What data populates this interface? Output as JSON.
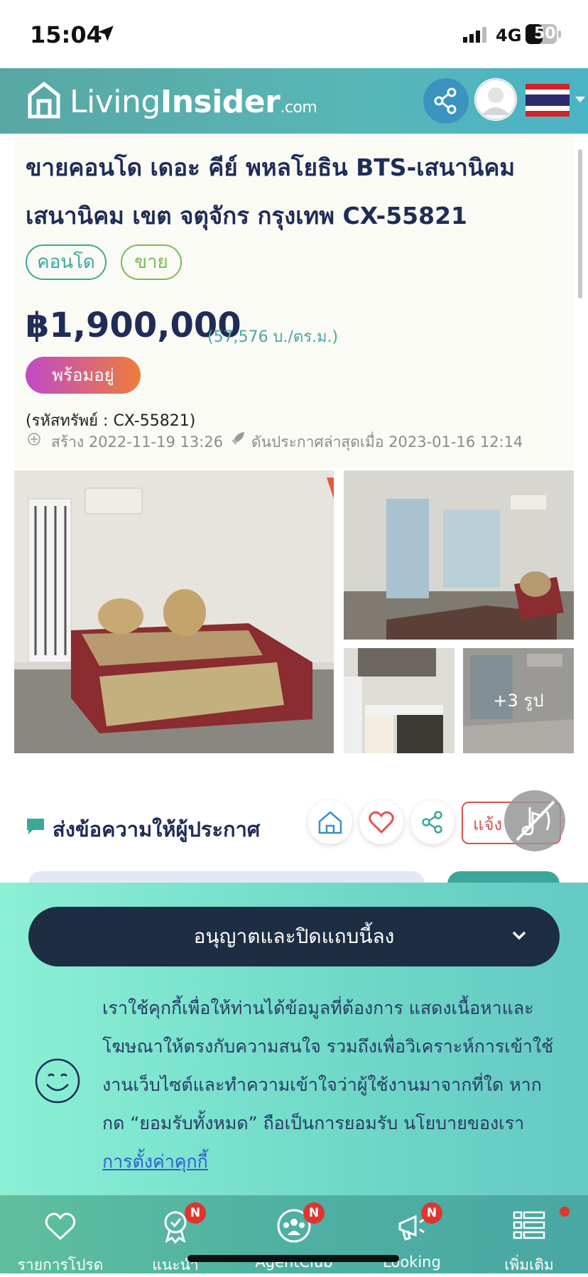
{
  "status": {
    "time": "15:04",
    "network": "4G",
    "battery": "50"
  },
  "header": {
    "logo_light": "Living",
    "logo_bold": "Insider",
    "logo_suffix": ".com"
  },
  "listing": {
    "title_line1": "ขายคอนโด เดอะ คีย์ พหลโยธิน BTS-เสนานิคม",
    "title_line2": "เสนานิคม เขต จตุจักร กรุงเทพ CX-55821",
    "tags": [
      "คอนโด",
      "ขาย"
    ],
    "price": "฿1,900,000",
    "price_per_sqm": "(57,576 บ./ตร.ม.)",
    "status_badge": "พร้อมอยู่",
    "code": "(รหัสทรัพย์ : CX-55821)",
    "created": "สร้าง 2022-11-19 13:26",
    "boosted": "ดันประกาศล่าสุดเมื่อ 2023-01-16 12:14",
    "more_photos": "+3 รูป"
  },
  "message": {
    "title": "ส่งข้อความให้ผู้ประกาศ",
    "report_label": "แจ้งรายงาน"
  },
  "cookie": {
    "accept_label": "อนุญาตและปิดแถบนี้ลง",
    "text": "เราใช้คุกกี้เพื่อให้ท่านได้ข้อมูลที่ต้องการ แสดงเนื้อหาและโฆษณาให้ตรงกับความสนใจ รวมถึงเพื่อวิเคราะห์การเข้าใช้งานเว็บไซต์และทำความเข้าใจว่าผู้ใช้งานมาจากที่ใด หากกด “ยอมรับทั้งหมด” ถือเป็นการยอมรับ นโยบายของเรา ",
    "link": "การตั้งค่าคุกกี้"
  },
  "bottom_nav": [
    {
      "label": "รายการโปรด",
      "icon": "heart-icon"
    },
    {
      "label": "แนะนำ",
      "icon": "award-icon",
      "badge": "N"
    },
    {
      "label": "AgentClub",
      "icon": "group-icon",
      "badge": "N"
    },
    {
      "label": "Looking",
      "icon": "megaphone-icon",
      "badge": "N"
    },
    {
      "label": "เพิ่มเติม",
      "icon": "menu-icon"
    }
  ],
  "colors": {
    "primary": "#1f2c57",
    "teal": "#4aa7a3",
    "accent_red": "#e0342f"
  }
}
